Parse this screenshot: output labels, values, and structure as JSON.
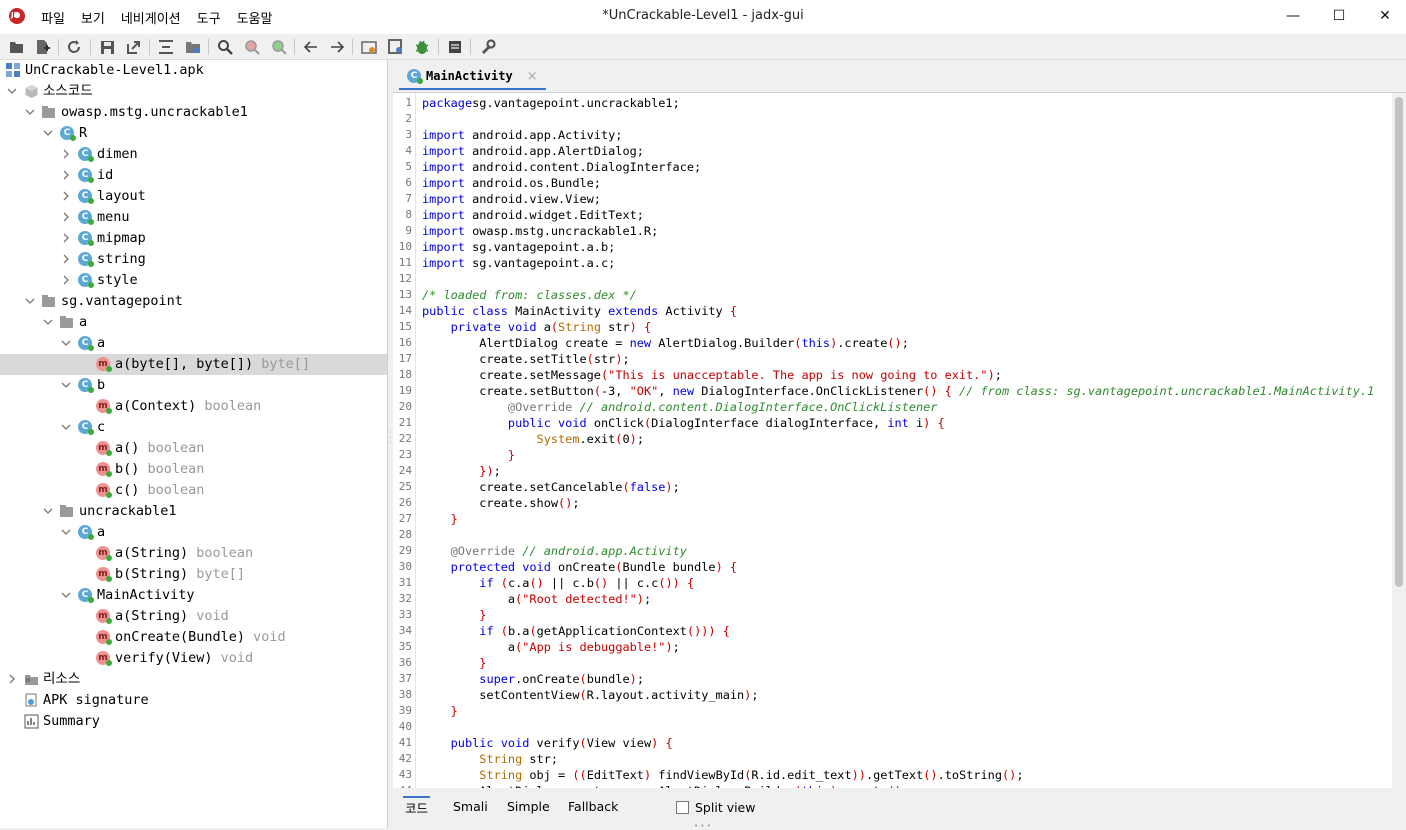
{
  "window": {
    "title": "*UnCrackable-Level1 - jadx-gui",
    "minimize": "—",
    "maximize": "☐",
    "close": "✕"
  },
  "menu": [
    "파일",
    "보기",
    "네비게이션",
    "도구",
    "도움말"
  ],
  "toolbar": {
    "icons": [
      "open-file-icon",
      "add-files-icon",
      "reload-icon",
      "save-all-icon",
      "export-icon",
      "sync-tree-icon",
      "flatten-packages-icon",
      "search-icon",
      "find-class-icon",
      "find-usage-icon",
      "back-icon",
      "forward-icon",
      "quark-icon",
      "deobfuscation-icon",
      "debugger-icon",
      "log-viewer-icon",
      "preferences-icon"
    ]
  },
  "tree": {
    "rows": [
      {
        "label": "UnCrackable-Level1.apk",
        "type": "",
        "icon": "apk-icon",
        "depth": 0,
        "twisty": ""
      },
      {
        "label": "소스코드",
        "type": "",
        "icon": "source-folder-icon",
        "depth": 0,
        "twisty": "open"
      },
      {
        "label": "owasp.mstg.uncrackable1",
        "type": "",
        "icon": "package-icon",
        "depth": 1,
        "twisty": "open"
      },
      {
        "label": "R",
        "type": "",
        "icon": "class-icon",
        "depth": 2,
        "twisty": "open"
      },
      {
        "label": "dimen",
        "type": "",
        "icon": "class-icon",
        "depth": 3,
        "twisty": "closed"
      },
      {
        "label": "id",
        "type": "",
        "icon": "class-icon",
        "depth": 3,
        "twisty": "closed"
      },
      {
        "label": "layout",
        "type": "",
        "icon": "class-icon",
        "depth": 3,
        "twisty": "closed"
      },
      {
        "label": "menu",
        "type": "",
        "icon": "class-icon",
        "depth": 3,
        "twisty": "closed"
      },
      {
        "label": "mipmap",
        "type": "",
        "icon": "class-icon",
        "depth": 3,
        "twisty": "closed"
      },
      {
        "label": "string",
        "type": "",
        "icon": "class-icon",
        "depth": 3,
        "twisty": "closed"
      },
      {
        "label": "style",
        "type": "",
        "icon": "class-icon",
        "depth": 3,
        "twisty": "closed"
      },
      {
        "label": "sg.vantagepoint",
        "type": "",
        "icon": "package-icon",
        "depth": 1,
        "twisty": "open"
      },
      {
        "label": "a",
        "type": "",
        "icon": "package-icon",
        "depth": 2,
        "twisty": "open"
      },
      {
        "label": "a",
        "type": "",
        "icon": "class-icon",
        "depth": 3,
        "twisty": "open"
      },
      {
        "label": "a(byte[], byte[])",
        "type": "byte[]",
        "icon": "method-icon",
        "depth": 4,
        "twisty": "",
        "selected": true
      },
      {
        "label": "b",
        "type": "",
        "icon": "class-icon",
        "depth": 3,
        "twisty": "open"
      },
      {
        "label": "a(Context)",
        "type": "boolean",
        "icon": "method-icon",
        "depth": 4,
        "twisty": ""
      },
      {
        "label": "c",
        "type": "",
        "icon": "class-icon",
        "depth": 3,
        "twisty": "open"
      },
      {
        "label": "a()",
        "type": "boolean",
        "icon": "method-icon",
        "depth": 4,
        "twisty": ""
      },
      {
        "label": "b()",
        "type": "boolean",
        "icon": "method-icon",
        "depth": 4,
        "twisty": ""
      },
      {
        "label": "c()",
        "type": "boolean",
        "icon": "method-icon",
        "depth": 4,
        "twisty": ""
      },
      {
        "label": "uncrackable1",
        "type": "",
        "icon": "package-icon",
        "depth": 2,
        "twisty": "open"
      },
      {
        "label": "a",
        "type": "",
        "icon": "class-icon",
        "depth": 3,
        "twisty": "open"
      },
      {
        "label": "a(String)",
        "type": "boolean",
        "icon": "method-icon",
        "depth": 4,
        "twisty": ""
      },
      {
        "label": "b(String)",
        "type": "byte[]",
        "icon": "method-icon",
        "depth": 4,
        "twisty": ""
      },
      {
        "label": "MainActivity",
        "type": "",
        "icon": "class-icon",
        "depth": 3,
        "twisty": "open"
      },
      {
        "label": "a(String)",
        "type": "void",
        "icon": "method-icon",
        "depth": 4,
        "twisty": ""
      },
      {
        "label": "onCreate(Bundle)",
        "type": "void",
        "icon": "method-icon",
        "depth": 4,
        "twisty": ""
      },
      {
        "label": "verify(View)",
        "type": "void",
        "icon": "method-icon",
        "depth": 4,
        "twisty": ""
      },
      {
        "label": "리소스",
        "type": "",
        "icon": "resources-folder-icon",
        "depth": 0,
        "twisty": "closed"
      },
      {
        "label": "APK signature",
        "type": "",
        "icon": "certificate-icon",
        "depth": 0,
        "twisty": ""
      },
      {
        "label": "Summary",
        "type": "",
        "icon": "summary-icon",
        "depth": 0,
        "twisty": ""
      }
    ]
  },
  "editor": {
    "tab_label": "MainActivity",
    "tab_close": "×",
    "lines": [
      [
        [
          "kw",
          "package"
        ],
        [
          "",
          "sg.vantagepoint.uncrackable1;"
        ]
      ],
      [],
      [
        [
          "kw",
          "import"
        ],
        [
          "",
          " android.app.Activity;"
        ]
      ],
      [
        [
          "kw",
          "import"
        ],
        [
          "",
          " android.app.AlertDialog;"
        ]
      ],
      [
        [
          "kw",
          "import"
        ],
        [
          "",
          " android.content.DialogInterface;"
        ]
      ],
      [
        [
          "kw",
          "import"
        ],
        [
          "",
          " android.os.Bundle;"
        ]
      ],
      [
        [
          "kw",
          "import"
        ],
        [
          "",
          " android.view.View;"
        ]
      ],
      [
        [
          "kw",
          "import"
        ],
        [
          "",
          " android.widget.EditText;"
        ]
      ],
      [
        [
          "kw",
          "import"
        ],
        [
          "",
          " owasp.mstg.uncrackable1.R;"
        ]
      ],
      [
        [
          "kw",
          "import"
        ],
        [
          "",
          " sg.vantagepoint.a.b;"
        ]
      ],
      [
        [
          "kw",
          "import"
        ],
        [
          "",
          " sg.vantagepoint.a.c;"
        ]
      ],
      [],
      [
        [
          "cm",
          "/* loaded from: classes.dex */"
        ]
      ],
      [
        [
          "kw",
          "public class"
        ],
        [
          "",
          " MainActivity "
        ],
        [
          "kw",
          "extends"
        ],
        [
          "",
          " Activity "
        ],
        [
          "pn",
          "{"
        ]
      ],
      [
        [
          "",
          "    "
        ],
        [
          "kw",
          "private void"
        ],
        [
          "",
          " a"
        ],
        [
          "pn",
          "("
        ],
        [
          "ty",
          "String"
        ],
        [
          "",
          " str"
        ],
        [
          "pn",
          ")"
        ],
        [
          "",
          " "
        ],
        [
          "pn",
          "{"
        ]
      ],
      [
        [
          "",
          "        AlertDialog create = "
        ],
        [
          "kw",
          "new"
        ],
        [
          "",
          " AlertDialog.Builder"
        ],
        [
          "pn",
          "("
        ],
        [
          "kw",
          "this"
        ],
        [
          "pn",
          ")"
        ],
        [
          "",
          ".create"
        ],
        [
          "pn",
          "()"
        ],
        [
          "",
          ";"
        ]
      ],
      [
        [
          "",
          "        create.setTitle"
        ],
        [
          "pn",
          "("
        ],
        [
          "",
          "str"
        ],
        [
          "pn",
          ")"
        ],
        [
          "",
          ";"
        ]
      ],
      [
        [
          "",
          "        create.setMessage"
        ],
        [
          "pn",
          "("
        ],
        [
          "str",
          "\"This is unacceptable. The app is now going to exit.\""
        ],
        [
          "pn",
          ")"
        ],
        [
          "",
          ";"
        ]
      ],
      [
        [
          "",
          "        create.setButton"
        ],
        [
          "pn",
          "("
        ],
        [
          "",
          "-3, "
        ],
        [
          "str",
          "\"OK\""
        ],
        [
          "",
          ", "
        ],
        [
          "kw",
          "new"
        ],
        [
          "",
          " DialogInterface.OnClickListener"
        ],
        [
          "pn",
          "()"
        ],
        [
          "",
          " "
        ],
        [
          "pn",
          "{"
        ],
        [
          "",
          " "
        ],
        [
          "cm",
          "// from class: sg.vantagepoint.uncrackable1.MainActivity.1"
        ]
      ],
      [
        [
          "",
          "            "
        ],
        [
          "ann",
          "@Override"
        ],
        [
          "",
          " "
        ],
        [
          "cm",
          "// android.content.DialogInterface.OnClickListener"
        ]
      ],
      [
        [
          "",
          "            "
        ],
        [
          "kw",
          "public void"
        ],
        [
          "",
          " onClick"
        ],
        [
          "pn",
          "("
        ],
        [
          "",
          "DialogInterface dialogInterface, "
        ],
        [
          "kw",
          "int"
        ],
        [
          "",
          " i"
        ],
        [
          "pn",
          ")"
        ],
        [
          "",
          " "
        ],
        [
          "pn",
          "{"
        ]
      ],
      [
        [
          "",
          "                "
        ],
        [
          "ty",
          "System"
        ],
        [
          "",
          ".exit"
        ],
        [
          "pn",
          "("
        ],
        [
          "",
          "0"
        ],
        [
          "pn",
          ")"
        ],
        [
          "",
          ";"
        ]
      ],
      [
        [
          "",
          "            "
        ],
        [
          "pn",
          "}"
        ]
      ],
      [
        [
          "",
          "        "
        ],
        [
          "pn",
          "})"
        ],
        [
          "",
          ";"
        ]
      ],
      [
        [
          "",
          "        create.setCancelable"
        ],
        [
          "pn",
          "("
        ],
        [
          "kw",
          "false"
        ],
        [
          "pn",
          ")"
        ],
        [
          "",
          ";"
        ]
      ],
      [
        [
          "",
          "        create.show"
        ],
        [
          "pn",
          "()"
        ],
        [
          "",
          ";"
        ]
      ],
      [
        [
          "",
          "    "
        ],
        [
          "pn",
          "}"
        ]
      ],
      [],
      [
        [
          "",
          "    "
        ],
        [
          "ann",
          "@Override"
        ],
        [
          "",
          " "
        ],
        [
          "cm",
          "// android.app.Activity"
        ]
      ],
      [
        [
          "",
          "    "
        ],
        [
          "kw",
          "protected void"
        ],
        [
          "",
          " onCreate"
        ],
        [
          "pn",
          "("
        ],
        [
          "",
          "Bundle bundle"
        ],
        [
          "pn",
          ")"
        ],
        [
          "",
          " "
        ],
        [
          "pn",
          "{"
        ]
      ],
      [
        [
          "",
          "        "
        ],
        [
          "kw",
          "if"
        ],
        [
          "",
          " "
        ],
        [
          "pn",
          "("
        ],
        [
          "",
          "c.a"
        ],
        [
          "pn",
          "()"
        ],
        [
          "",
          " || c.b"
        ],
        [
          "pn",
          "()"
        ],
        [
          "",
          " || c.c"
        ],
        [
          "pn",
          "())"
        ],
        [
          "",
          " "
        ],
        [
          "pn",
          "{"
        ]
      ],
      [
        [
          "",
          "            a"
        ],
        [
          "pn",
          "("
        ],
        [
          "str",
          "\"Root detected!\""
        ],
        [
          "pn",
          ")"
        ],
        [
          "",
          ";"
        ]
      ],
      [
        [
          "",
          "        "
        ],
        [
          "pn",
          "}"
        ]
      ],
      [
        [
          "",
          "        "
        ],
        [
          "kw",
          "if"
        ],
        [
          "",
          " "
        ],
        [
          "pn",
          "("
        ],
        [
          "",
          "b.a"
        ],
        [
          "pn",
          "("
        ],
        [
          "",
          "getApplicationContext"
        ],
        [
          "pn",
          "()))"
        ],
        [
          "",
          " "
        ],
        [
          "pn",
          "{"
        ]
      ],
      [
        [
          "",
          "            a"
        ],
        [
          "pn",
          "("
        ],
        [
          "str",
          "\"App is debuggable!\""
        ],
        [
          "pn",
          ")"
        ],
        [
          "",
          ";"
        ]
      ],
      [
        [
          "",
          "        "
        ],
        [
          "pn",
          "}"
        ]
      ],
      [
        [
          "",
          "        "
        ],
        [
          "kw",
          "super"
        ],
        [
          "",
          ".onCreate"
        ],
        [
          "pn",
          "("
        ],
        [
          "",
          "bundle"
        ],
        [
          "pn",
          ")"
        ],
        [
          "",
          ";"
        ]
      ],
      [
        [
          "",
          "        setContentView"
        ],
        [
          "pn",
          "("
        ],
        [
          "",
          "R.layout.activity_main"
        ],
        [
          "pn",
          ")"
        ],
        [
          "",
          ";"
        ]
      ],
      [
        [
          "",
          "    "
        ],
        [
          "pn",
          "}"
        ]
      ],
      [],
      [
        [
          "",
          "    "
        ],
        [
          "kw",
          "public void"
        ],
        [
          "",
          " verify"
        ],
        [
          "pn",
          "("
        ],
        [
          "",
          "View view"
        ],
        [
          "pn",
          ")"
        ],
        [
          "",
          " "
        ],
        [
          "pn",
          "{"
        ]
      ],
      [
        [
          "",
          "        "
        ],
        [
          "ty",
          "String"
        ],
        [
          "",
          " str;"
        ]
      ],
      [
        [
          "",
          "        "
        ],
        [
          "ty",
          "String"
        ],
        [
          "",
          " obj = "
        ],
        [
          "pn",
          "(("
        ],
        [
          "",
          "EditText"
        ],
        [
          "pn",
          ")"
        ],
        [
          "",
          " findViewById"
        ],
        [
          "pn",
          "("
        ],
        [
          "",
          "R.id.edit_text"
        ],
        [
          "pn",
          "))"
        ],
        [
          "",
          ".getText"
        ],
        [
          "pn",
          "()"
        ],
        [
          "",
          ".toString"
        ],
        [
          "pn",
          "()"
        ],
        [
          "",
          ";"
        ]
      ],
      [
        [
          "",
          "        AlertDialog create = "
        ],
        [
          "kw",
          "new"
        ],
        [
          "",
          " AlertDialog.Builder"
        ],
        [
          "pn",
          "("
        ],
        [
          "kw",
          "this"
        ],
        [
          "pn",
          ")"
        ],
        [
          "",
          ".create"
        ],
        [
          "pn",
          "()"
        ],
        [
          "",
          ";"
        ]
      ]
    ]
  },
  "bottom_tabs": {
    "code": "코드",
    "smali": "Smali",
    "simple": "Simple",
    "fallback": "Fallback",
    "split_view": "Split view"
  }
}
